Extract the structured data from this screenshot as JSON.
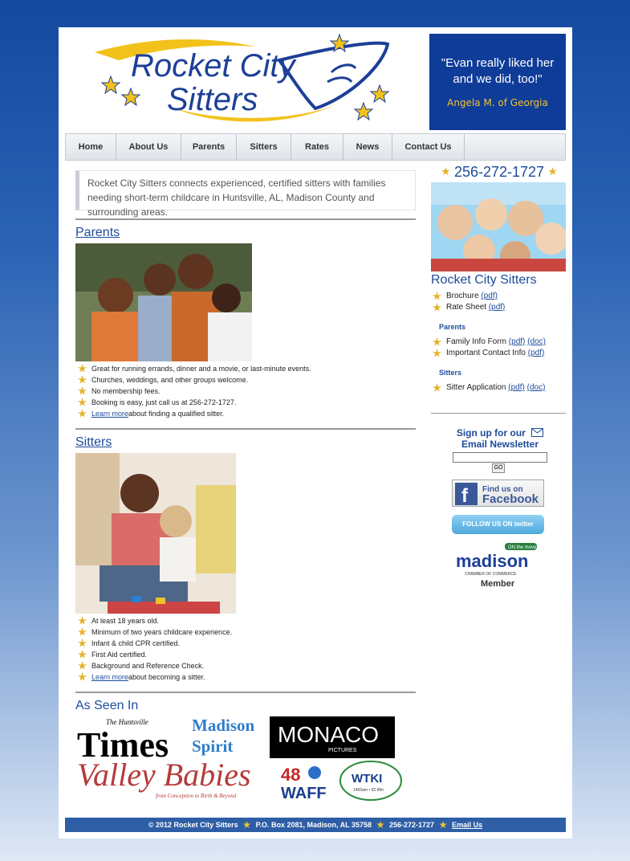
{
  "header": {
    "logo_line1": "Rocket City",
    "logo_line2": "Sitters",
    "quote_text": "\"Evan really liked her and we did, too!\"",
    "quote_author": "Angela M. of Georgia"
  },
  "nav": {
    "items": [
      "Home",
      "About Us",
      "Parents",
      "Sitters",
      "Rates",
      "News",
      "Contact Us"
    ]
  },
  "intro": "Rocket City Sitters connects experienced, certified sitters with families needing short-term childcare in Huntsville, AL, Madison County and surrounding areas.",
  "parents": {
    "title": "Parents",
    "bullets": [
      "Great for running errands, dinner and a movie, or last-minute events.",
      "Churches, weddings, and other groups welcome.",
      "No membership fees.",
      "Booking is easy, just call us at 256-272-1727."
    ],
    "learn_more_link": "Learn more",
    "learn_more_rest": " about finding a qualified sitter."
  },
  "sitters": {
    "title": "Sitters",
    "bullets": [
      "At least 18 years old.",
      "Minimum of two years childcare experience.",
      "Infant & child CPR certified.",
      "First Aid certified.",
      "Background and Reference Check."
    ],
    "learn_more_link": "Learn more",
    "learn_more_rest": " about becoming a sitter."
  },
  "as_seen_in": {
    "title": "As Seen In",
    "times_small": "The Huntsville",
    "times": "Times",
    "madison_spirit_1": "Madison",
    "madison_spirit_2": "Spirit",
    "monaco": "MONACO",
    "monaco_sub": "PICTURES",
    "valley_babies": "Valley Babies",
    "valley_babies_sub": "from Conception to Birth & Beyond",
    "waff_num": "48",
    "waff": "WAFF",
    "wtki": "WTKI",
    "wtki_sub": "1450am • 92.9fm"
  },
  "sidebar": {
    "phone": "256-272-1727",
    "title": "Rocket City Sitters",
    "general": [
      {
        "label": "Brochure",
        "links": [
          "(pdf)"
        ]
      },
      {
        "label": "Rate Sheet",
        "links": [
          "(pdf)"
        ]
      }
    ],
    "parents_heading": "Parents",
    "parents": [
      {
        "label": "Family Info Form",
        "links": [
          "(pdf)",
          "(doc)"
        ]
      },
      {
        "label": "Important Contact Info",
        "links": [
          "(pdf)"
        ]
      }
    ],
    "sitters_heading": "Sitters",
    "sitters": [
      {
        "label": "Sitter Application",
        "links": [
          "(pdf)",
          "(doc)"
        ]
      }
    ],
    "newsletter_line1": "Sign up for our",
    "newsletter_line2": "Email Newsletter",
    "go_label": "GO",
    "facebook_line1": "Find us on",
    "facebook_line2": "Facebook",
    "twitter": "FOLLOW US ON twitter",
    "madison_on": "ON the move",
    "madison": "madison",
    "madison_sub": "CHAMBER OF COMMERCE",
    "madison_member": "Member"
  },
  "footer": {
    "copyright": "© 2012 Rocket City Sitters",
    "address": "P.O. Box 2081, Madison, AL 35758",
    "phone": "256-272-1727",
    "email": "Email Us"
  }
}
